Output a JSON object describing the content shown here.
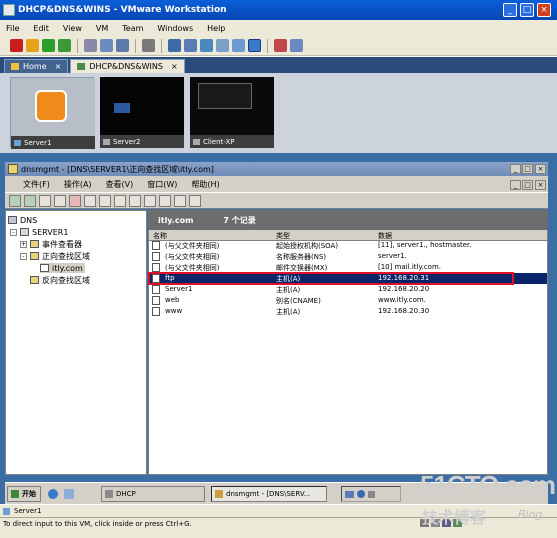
{
  "window": {
    "title": "DHCP&DNS&WINS - VMware Workstation",
    "minimize": "_",
    "maximize": "□",
    "close": "×"
  },
  "menu": [
    "File",
    "Edit",
    "View",
    "VM",
    "Team",
    "Windows",
    "Help"
  ],
  "tabs": [
    {
      "label": "Home",
      "close": "×"
    },
    {
      "label": "DHCP&DNS&WINS",
      "close": "×"
    }
  ],
  "thumbnails": [
    {
      "label": "Server1"
    },
    {
      "label": "Server2"
    },
    {
      "label": "Client-XP"
    }
  ],
  "mmc": {
    "title": "dnsmgmt - [DNS\\SERVER1\\正向查找区域\\itly.com]",
    "menu": [
      "文件(F)",
      "操作(A)",
      "查看(V)",
      "窗口(W)",
      "帮助(H)"
    ]
  },
  "tree": {
    "root": "DNS",
    "server": "SERVER1",
    "events": "事件查看器",
    "forward": "正向查找区域",
    "zone": "itly.com",
    "reverse": "反向查找区域"
  },
  "detail": {
    "zone": "itly.com",
    "count": "7 个记录",
    "columns": {
      "name": "名称",
      "type": "类型",
      "data": "数据"
    },
    "records": [
      {
        "name": "(与父文件夹相同)",
        "type": "起始授权机构(SOA)",
        "data": "[11], server1., hostmaster."
      },
      {
        "name": "(与父文件夹相同)",
        "type": "名称服务器(NS)",
        "data": "server1."
      },
      {
        "name": "(与父文件夹相同)",
        "type": "邮件交换器(MX)",
        "data": "[10]  mail.itly.com."
      },
      {
        "name": "ftp",
        "type": "主机(A)",
        "data": "192.168.20.31"
      },
      {
        "name": "Server1",
        "type": "主机(A)",
        "data": "192.168.20.20"
      },
      {
        "name": "web",
        "type": "别名(CNAME)",
        "data": "www.itly.com."
      },
      {
        "name": "www",
        "type": "主机(A)",
        "data": "192.168.20.30"
      }
    ]
  },
  "guest_taskbar": {
    "start": "开始",
    "dhcp": "DHCP",
    "dnsmgmt": "dnsmgmt - [DNS\\SERV..."
  },
  "status_strip": {
    "label": "Server1"
  },
  "statusbar": {
    "text": "To direct input to this VM, click inside or press Ctrl+G."
  },
  "watermark": {
    "site": "51CTO.com",
    "cn": "技术博客",
    "blog": "Blog"
  }
}
